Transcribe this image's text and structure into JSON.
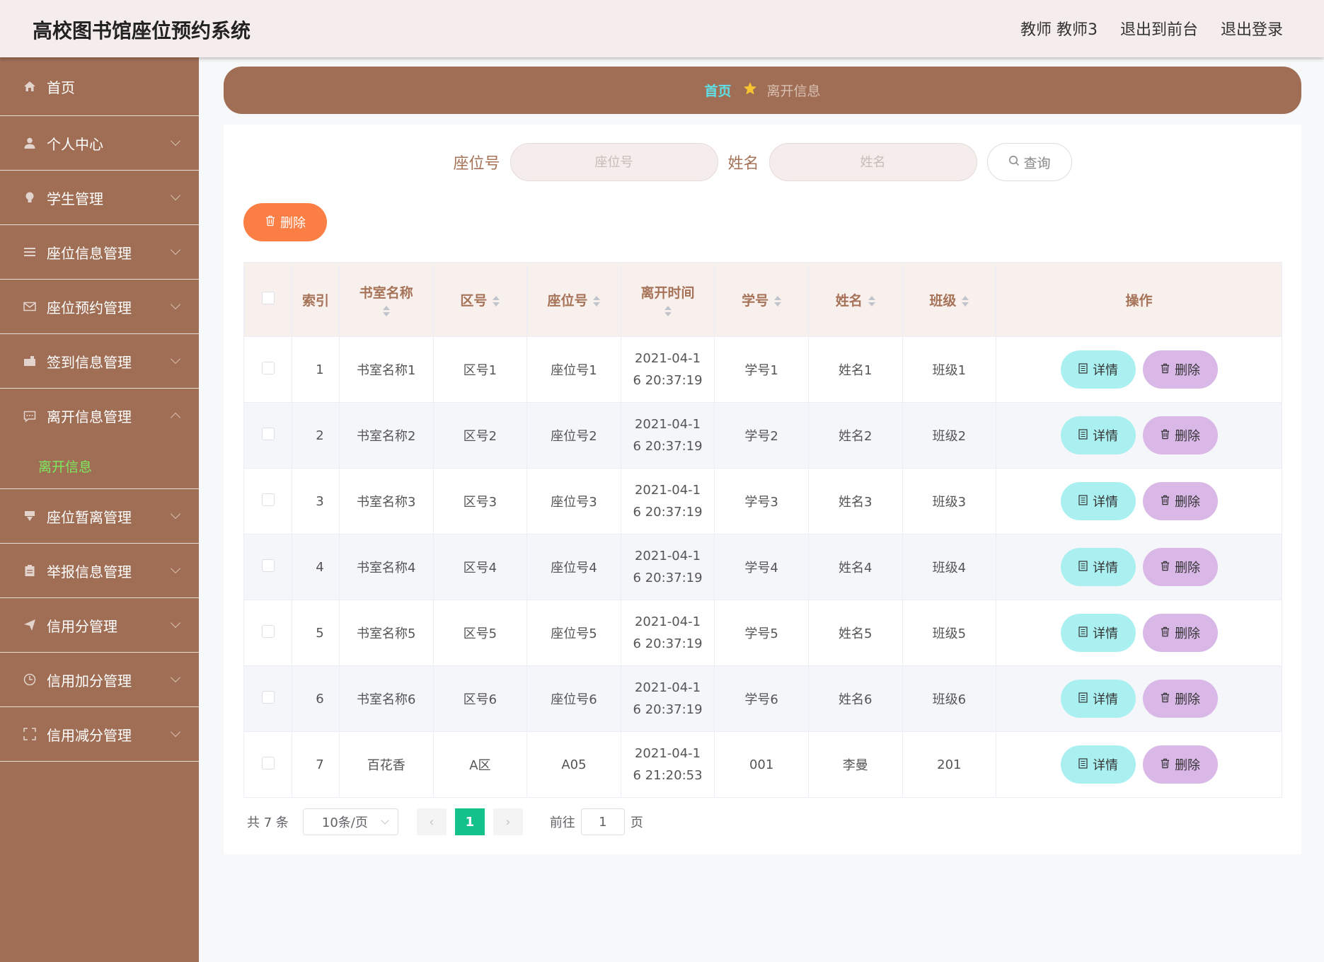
{
  "header": {
    "title": "高校图书馆座位预约系统",
    "user": "教师 教师3",
    "to_front": "退出到前台",
    "logout": "退出登录"
  },
  "sidebar": {
    "items": [
      {
        "label": "首页",
        "icon": "home-icon"
      },
      {
        "label": "个人中心",
        "icon": "user-icon"
      },
      {
        "label": "学生管理",
        "icon": "lightbulb-icon"
      },
      {
        "label": "座位信息管理",
        "icon": "list-icon"
      },
      {
        "label": "座位预约管理",
        "icon": "mail-icon"
      },
      {
        "label": "签到信息管理",
        "icon": "briefcase-icon"
      },
      {
        "label": "离开信息管理",
        "icon": "chat-icon"
      },
      {
        "label": "座位暂离管理",
        "icon": "bookmark-icon"
      },
      {
        "label": "举报信息管理",
        "icon": "clipboard-icon"
      },
      {
        "label": "信用分管理",
        "icon": "send-icon"
      },
      {
        "label": "信用加分管理",
        "icon": "clock-icon"
      },
      {
        "label": "信用减分管理",
        "icon": "fullscreen-icon"
      }
    ],
    "active_sub": "离开信息"
  },
  "breadcrumb": {
    "home": "首页",
    "current": "离开信息"
  },
  "search": {
    "seat_label": "座位号",
    "seat_placeholder": "座位号",
    "name_label": "姓名",
    "name_placeholder": "姓名",
    "query_label": "查询"
  },
  "toolbar": {
    "delete_label": "删除"
  },
  "table": {
    "headers": [
      "索引",
      "书室名称",
      "区号",
      "座位号",
      "离开时间",
      "学号",
      "姓名",
      "班级",
      "操作"
    ],
    "detail_label": "详情",
    "delete_label": "删除",
    "rows": [
      {
        "idx": "1",
        "room": "书室名称1",
        "zone": "区号1",
        "seat": "座位号1",
        "time_a": "2021-04-1",
        "time_b": "6 20:37:19",
        "sid": "学号1",
        "name": "姓名1",
        "cls": "班级1"
      },
      {
        "idx": "2",
        "room": "书室名称2",
        "zone": "区号2",
        "seat": "座位号2",
        "time_a": "2021-04-1",
        "time_b": "6 20:37:19",
        "sid": "学号2",
        "name": "姓名2",
        "cls": "班级2"
      },
      {
        "idx": "3",
        "room": "书室名称3",
        "zone": "区号3",
        "seat": "座位号3",
        "time_a": "2021-04-1",
        "time_b": "6 20:37:19",
        "sid": "学号3",
        "name": "姓名3",
        "cls": "班级3"
      },
      {
        "idx": "4",
        "room": "书室名称4",
        "zone": "区号4",
        "seat": "座位号4",
        "time_a": "2021-04-1",
        "time_b": "6 20:37:19",
        "sid": "学号4",
        "name": "姓名4",
        "cls": "班级4"
      },
      {
        "idx": "5",
        "room": "书室名称5",
        "zone": "区号5",
        "seat": "座位号5",
        "time_a": "2021-04-1",
        "time_b": "6 20:37:19",
        "sid": "学号5",
        "name": "姓名5",
        "cls": "班级5"
      },
      {
        "idx": "6",
        "room": "书室名称6",
        "zone": "区号6",
        "seat": "座位号6",
        "time_a": "2021-04-1",
        "time_b": "6 20:37:19",
        "sid": "学号6",
        "name": "姓名6",
        "cls": "班级6"
      },
      {
        "idx": "7",
        "room": "百花香",
        "zone": "A区",
        "seat": "A05",
        "time_a": "2021-04-1",
        "time_b": "6 21:20:53",
        "sid": "001",
        "name": "李曼",
        "cls": "201"
      }
    ]
  },
  "pagination": {
    "total": "共 7 条",
    "page_size": "10条/页",
    "current": "1",
    "goto_label": "前往",
    "goto_value": "1",
    "page_suffix": "页"
  },
  "colors": {
    "sidebar": "#9f6e55",
    "accent_link": "#5ee0e8",
    "active_sub": "#7bea5f",
    "bulk_delete": "#fb7f45",
    "detail_btn": "#aaf0f0",
    "row_delete_btn": "#d9b8e8",
    "pager_active": "#13c18a"
  }
}
